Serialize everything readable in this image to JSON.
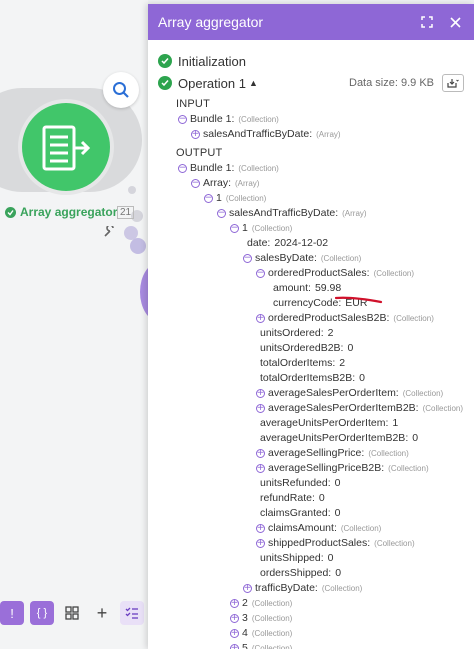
{
  "panel": {
    "title": "Array aggregator",
    "initialization": "Initialization",
    "operation": "Operation 1",
    "data_size": "Data size: 9.9 KB",
    "input_label": "INPUT",
    "output_label": "OUTPUT"
  },
  "canvas": {
    "module_label": "Array aggregator",
    "module_count": "21"
  },
  "input_tree": [
    {
      "indent": 0,
      "toggle": "-",
      "key": "Bundle 1:",
      "type": "(Collection)"
    },
    {
      "indent": 1,
      "toggle": "+",
      "key": "salesAndTrafficByDate:",
      "type": "(Array)"
    }
  ],
  "output_tree": [
    {
      "indent": 0,
      "toggle": "-",
      "key": "Bundle 1:",
      "type": "(Collection)"
    },
    {
      "indent": 1,
      "toggle": "-",
      "key": "Array:",
      "type": "(Array)"
    },
    {
      "indent": 2,
      "toggle": "-",
      "key": "1",
      "type": "(Collection)"
    },
    {
      "indent": 3,
      "toggle": "-",
      "key": "salesAndTrafficByDate:",
      "type": "(Array)"
    },
    {
      "indent": 4,
      "toggle": "-",
      "key": "1",
      "type": "(Collection)"
    },
    {
      "indent": 5,
      "toggle": "",
      "key": "date:",
      "value": "2024-12-02"
    },
    {
      "indent": 5,
      "toggle": "-",
      "key": "salesByDate:",
      "type": "(Collection)"
    },
    {
      "indent": 6,
      "toggle": "-",
      "key": "orderedProductSales:",
      "type": "(Collection)"
    },
    {
      "indent": 7,
      "toggle": "",
      "key": "amount:",
      "value": "59.98"
    },
    {
      "indent": 7,
      "toggle": "",
      "key": "currencyCode:",
      "value": "EUR"
    },
    {
      "indent": 6,
      "toggle": "+",
      "key": "orderedProductSalesB2B:",
      "type": "(Collection)"
    },
    {
      "indent": 6,
      "toggle": "",
      "key": "unitsOrdered:",
      "value": "2"
    },
    {
      "indent": 6,
      "toggle": "",
      "key": "unitsOrderedB2B:",
      "value": "0"
    },
    {
      "indent": 6,
      "toggle": "",
      "key": "totalOrderItems:",
      "value": "2"
    },
    {
      "indent": 6,
      "toggle": "",
      "key": "totalOrderItemsB2B:",
      "value": "0"
    },
    {
      "indent": 6,
      "toggle": "+",
      "key": "averageSalesPerOrderItem:",
      "type": "(Collection)"
    },
    {
      "indent": 6,
      "toggle": "+",
      "key": "averageSalesPerOrderItemB2B:",
      "type": "(Collection)"
    },
    {
      "indent": 6,
      "toggle": "",
      "key": "averageUnitsPerOrderItem:",
      "value": "1"
    },
    {
      "indent": 6,
      "toggle": "",
      "key": "averageUnitsPerOrderItemB2B:",
      "value": "0"
    },
    {
      "indent": 6,
      "toggle": "+",
      "key": "averageSellingPrice:",
      "type": "(Collection)"
    },
    {
      "indent": 6,
      "toggle": "+",
      "key": "averageSellingPriceB2B:",
      "type": "(Collection)"
    },
    {
      "indent": 6,
      "toggle": "",
      "key": "unitsRefunded:",
      "value": "0"
    },
    {
      "indent": 6,
      "toggle": "",
      "key": "refundRate:",
      "value": "0"
    },
    {
      "indent": 6,
      "toggle": "",
      "key": "claimsGranted:",
      "value": "0"
    },
    {
      "indent": 6,
      "toggle": "+",
      "key": "claimsAmount:",
      "type": "(Collection)"
    },
    {
      "indent": 6,
      "toggle": "+",
      "key": "shippedProductSales:",
      "type": "(Collection)"
    },
    {
      "indent": 6,
      "toggle": "",
      "key": "unitsShipped:",
      "value": "0"
    },
    {
      "indent": 6,
      "toggle": "",
      "key": "ordersShipped:",
      "value": "0"
    },
    {
      "indent": 5,
      "toggle": "+",
      "key": "trafficByDate:",
      "type": "(Collection)"
    },
    {
      "indent": 4,
      "toggle": "+",
      "key": "2",
      "type": "(Collection)"
    },
    {
      "indent": 4,
      "toggle": "+",
      "key": "3",
      "type": "(Collection)"
    },
    {
      "indent": 4,
      "toggle": "+",
      "key": "4",
      "type": "(Collection)"
    },
    {
      "indent": 4,
      "toggle": "+",
      "key": "5",
      "type": "(Collection)"
    }
  ],
  "colors": {
    "header": "#8e67d6",
    "module": "#41c66a",
    "success": "#2da44e",
    "annotation": "#d0112b"
  }
}
